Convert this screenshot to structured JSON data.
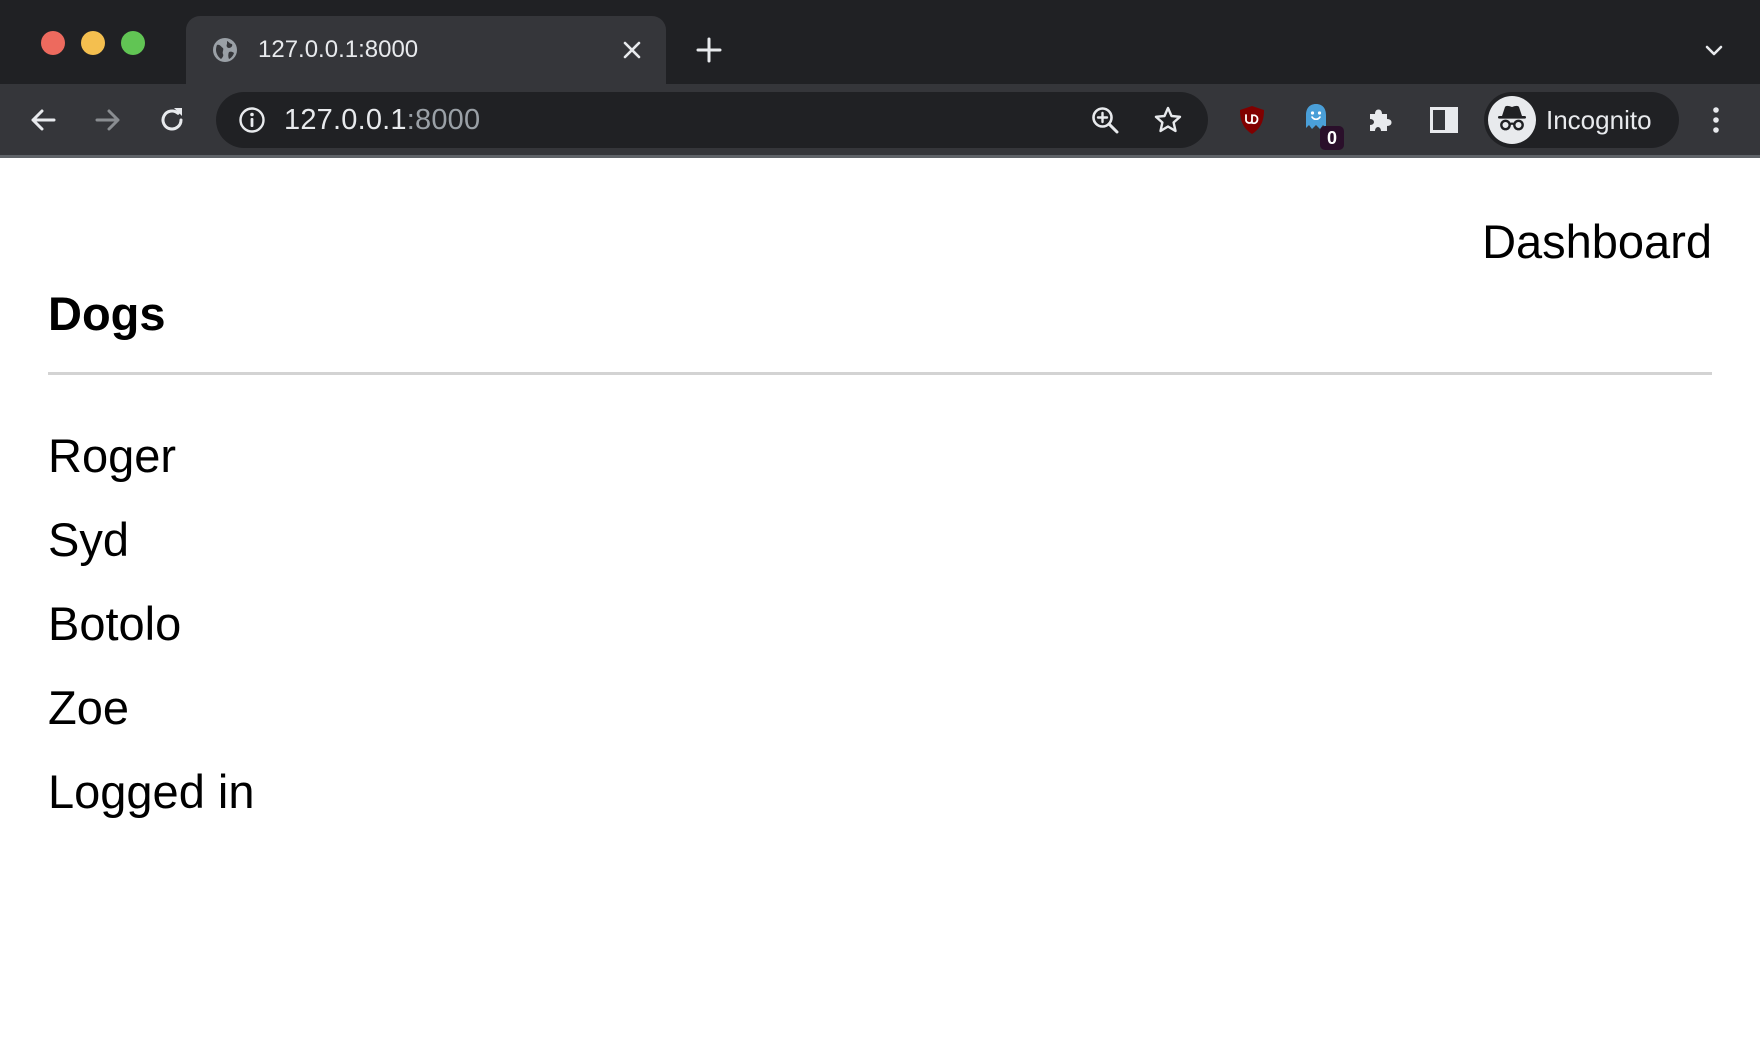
{
  "browser": {
    "tab": {
      "title": "127.0.0.1:8000"
    },
    "address_bar": {
      "host": "127.0.0.1",
      "port": ":8000"
    },
    "extensions": {
      "badge_count": "0"
    },
    "profile": {
      "label": "Incognito"
    },
    "colors": {
      "tabstrip": "#202124",
      "toolbar": "#35363a",
      "omnibox": "#202124",
      "ublock_red": "#800000",
      "ghostery_blue": "#4a9fd8"
    }
  },
  "page": {
    "nav": {
      "dashboard_label": "Dashboard"
    },
    "heading": "Dogs",
    "dogs": [
      "Roger",
      "Syd",
      "Botolo",
      "Zoe"
    ],
    "status_text": "Logged in"
  }
}
